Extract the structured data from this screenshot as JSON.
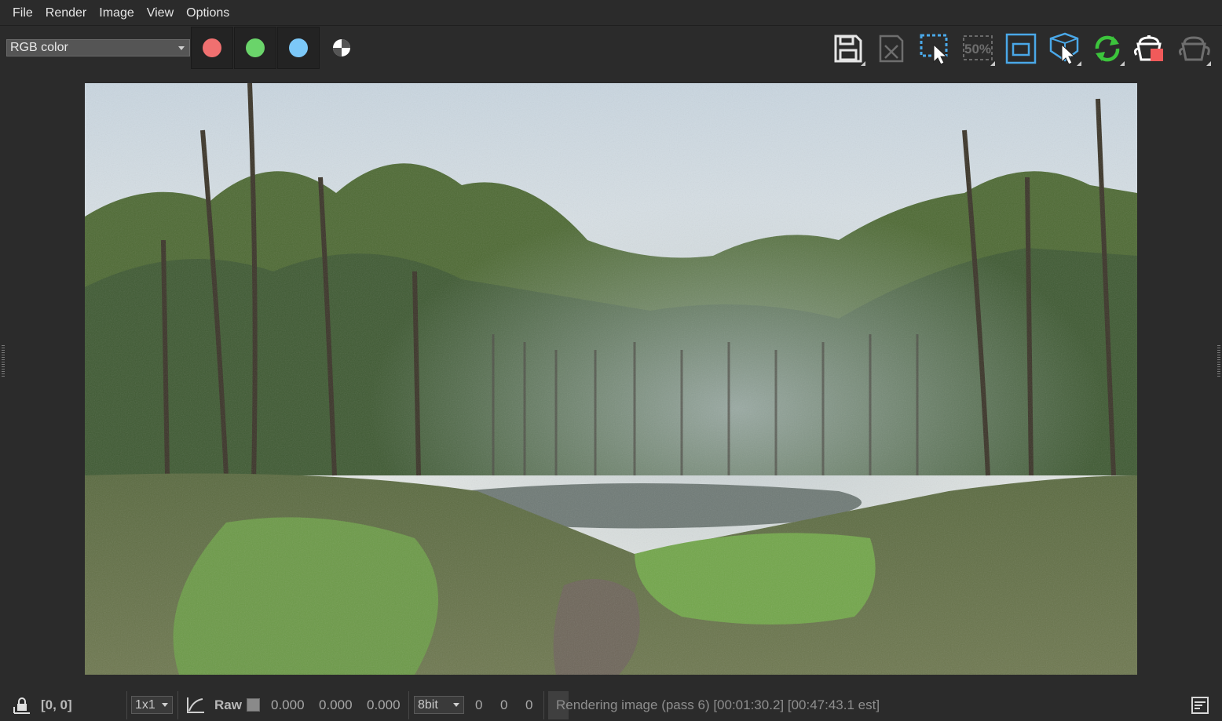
{
  "menubar": {
    "items": [
      {
        "label": "File"
      },
      {
        "label": "Render"
      },
      {
        "label": "Image"
      },
      {
        "label": "View"
      },
      {
        "label": "Options"
      }
    ]
  },
  "toolbar": {
    "channel_select": "RGB color",
    "channels": [
      {
        "name": "red-channel",
        "color": "#f07070"
      },
      {
        "name": "green-channel",
        "color": "#6ad46a"
      },
      {
        "name": "blue-channel",
        "color": "#7cc8f8"
      },
      {
        "name": "alpha-channel",
        "color": "#ffffff"
      }
    ],
    "tools": [
      "save-image-icon",
      "clear-frame-buffer-icon",
      "region-render-icon",
      "zoom-50-percent-icon",
      "safe-frame-icon",
      "track-mouse-icon",
      "interactive-render-icon",
      "render-stop-icon",
      "render-teapot-icon"
    ],
    "zoom_label": "50%"
  },
  "statusbar": {
    "coords": "[0, 0]",
    "sampling": "1x1",
    "raw_label": "Raw",
    "r_value": "0.000",
    "g_value": "0.000",
    "b_value": "0.000",
    "bit_depth": "8bit",
    "r_int": "0",
    "g_int": "0",
    "b_int": "0",
    "status": "Rendering image (pass 6) [00:01:30.2] [00:47:43.1 est]"
  },
  "colors": {
    "background": "#2b2b2b",
    "accent_green": "#3cc43c",
    "accent_blue": "#4aa8e8",
    "stop_red": "#f05a5a"
  }
}
